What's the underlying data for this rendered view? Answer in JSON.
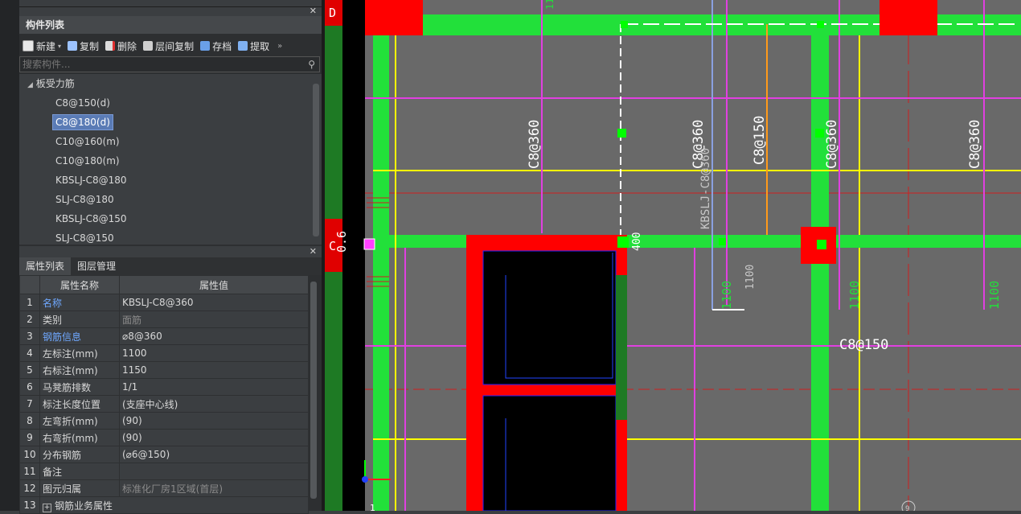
{
  "component_panel": {
    "title": "构件列表",
    "toolbar": {
      "new": "新建",
      "copy": "复制",
      "delete": "删除",
      "floor_copy": "层间复制",
      "save": "存档",
      "extract": "提取"
    },
    "search_placeholder": "搜索构件...",
    "tree_root": "板受力筋",
    "items": [
      "C8@150(d)",
      "C8@180(d)",
      "C10@160(m)",
      "C10@180(m)",
      "KBSLJ-C8@180",
      "SLJ-C8@180",
      "KBSLJ-C8@150",
      "SLJ-C8@150"
    ],
    "selected_item": "C8@180(d)"
  },
  "property_panel": {
    "tabs": [
      "属性列表",
      "图层管理"
    ],
    "col_name": "属性名称",
    "col_value": "属性值",
    "rows": [
      {
        "no": "1",
        "name": "名称",
        "value": "KBSLJ-C8@360"
      },
      {
        "no": "2",
        "name": "类别",
        "value": "面筋"
      },
      {
        "no": "3",
        "name": "钢筋信息",
        "value": "⌀8@360"
      },
      {
        "no": "4",
        "name": "左标注(mm)",
        "value": "1100"
      },
      {
        "no": "5",
        "name": "右标注(mm)",
        "value": "1150"
      },
      {
        "no": "6",
        "name": "马凳筋排数",
        "value": "1/1"
      },
      {
        "no": "7",
        "name": "标注长度位置",
        "value": "(支座中心线)"
      },
      {
        "no": "8",
        "name": "左弯折(mm)",
        "value": "(90)"
      },
      {
        "no": "9",
        "name": "右弯折(mm)",
        "value": "(90)"
      },
      {
        "no": "10",
        "name": "分布钢筋",
        "value": "(⌀6@150)"
      },
      {
        "no": "11",
        "name": "备注",
        "value": ""
      },
      {
        "no": "12",
        "name": "图元归属",
        "value": "标准化厂房1区域(首层)"
      },
      {
        "no": "13",
        "name": "钢筋业务属性",
        "value": ""
      }
    ]
  },
  "canvas": {
    "axis_labels": [
      "D",
      "C",
      "9"
    ],
    "rebar_labels": [
      "C8@360",
      "C8@360",
      "C8@150",
      "C8@360",
      "C8@360",
      "C8@150"
    ],
    "kbslj_label": "KBSLJ-C8@360",
    "dim_labels": [
      "1100",
      "1100",
      "1100",
      "1100",
      "1100",
      "400",
      "0.6",
      "1"
    ]
  },
  "colors": {
    "beam_green": "#22e03a",
    "column_red": "#ff0000",
    "rebar_magenta": "#e040e0",
    "line_yellow": "#ffff00",
    "canvas_bg": "#696969"
  }
}
